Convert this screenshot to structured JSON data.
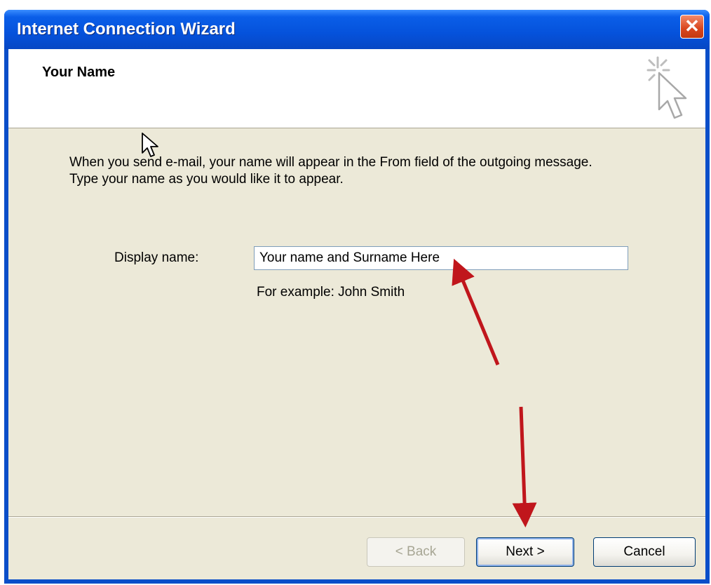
{
  "window": {
    "title": "Internet Connection Wizard",
    "close_symbol": "✕",
    "titlebar_color": "#0a52dc",
    "close_color": "#d8451d"
  },
  "header": {
    "title": "Your Name",
    "icon": "wizard-cursor-sparkle-icon"
  },
  "body": {
    "intro_line1": "When you send e-mail, your name will appear in the From field of the outgoing message.",
    "intro_line2": "Type your name as you would like it to appear.",
    "display_name_label": "Display name:",
    "display_name_value": "Your name and Surname Here",
    "example_text": "For example: John Smith"
  },
  "buttons": {
    "back_label": "< Back",
    "back_enabled": false,
    "next_label": "Next >",
    "cancel_label": "Cancel"
  },
  "annotations": {
    "arrow_color": "#c0161c",
    "arrows": [
      "arrow-to-display-name-field",
      "arrow-to-next-button"
    ]
  }
}
